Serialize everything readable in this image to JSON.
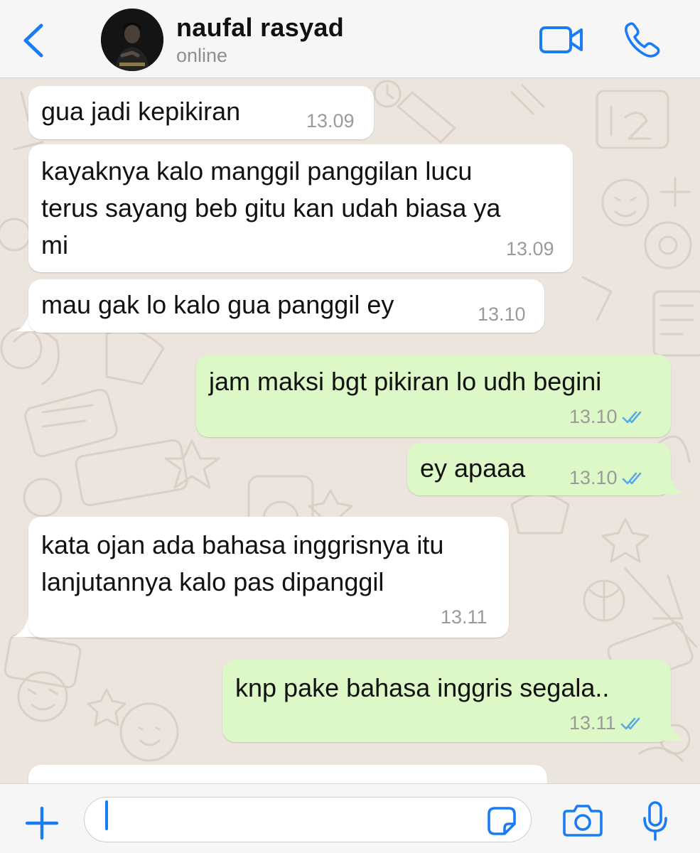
{
  "header": {
    "contact_name": "naufal rasyad",
    "status": "online",
    "icons": [
      "chevron-left-icon",
      "avatar",
      "video-camera-icon",
      "phone-icon"
    ],
    "accent_color": "#1a7cf5"
  },
  "messages": [
    {
      "direction": "incoming",
      "text": "gua jadi kepikiran",
      "time": "13.09"
    },
    {
      "direction": "incoming",
      "lines": [
        "kayaknya kalo manggil panggilan lucu",
        "terus sayang beb gitu kan udah biasa ya",
        "mi"
      ],
      "time": "13.09"
    },
    {
      "direction": "incoming",
      "text": "mau gak lo kalo gua panggil ey",
      "time": "13.10"
    },
    {
      "direction": "outgoing",
      "text": "jam maksi bgt pikiran lo udh begini",
      "time": "13.10",
      "status": "read"
    },
    {
      "direction": "outgoing",
      "text": "ey apaaa",
      "time": "13.10",
      "status": "read"
    },
    {
      "direction": "incoming",
      "lines": [
        "kata ojan ada bahasa inggrisnya itu",
        "lanjutannya kalo pas dipanggil"
      ],
      "time": "13.11"
    },
    {
      "direction": "outgoing",
      "text": "knp pake bahasa inggris segala..",
      "time": "13.11",
      "status": "read"
    }
  ],
  "colors": {
    "incoming_bubble": "#ffffff",
    "outgoing_bubble": "#dcf8c6",
    "read_ticks": "#5aa9e6",
    "chat_background": "#ece5dd"
  },
  "input_bar": {
    "message_value": "",
    "icons": [
      "plus-icon",
      "sticker-icon",
      "camera-icon",
      "microphone-icon"
    ]
  }
}
